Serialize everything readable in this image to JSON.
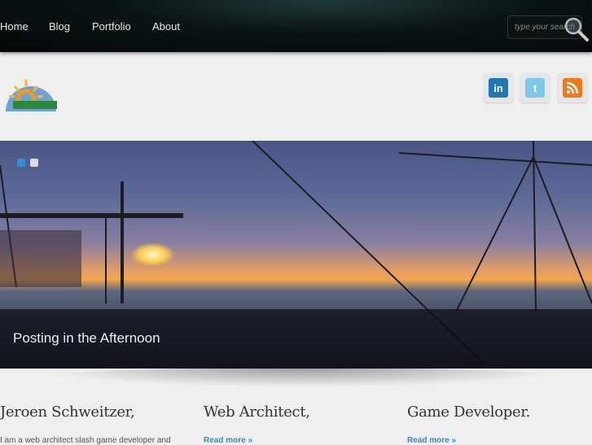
{
  "nav": {
    "items": [
      "Home",
      "Blog",
      "Portfolio",
      "About"
    ]
  },
  "search": {
    "placeholder": "type your search"
  },
  "social": [
    {
      "name": "linkedin",
      "label": "in",
      "color": "#1f78b4"
    },
    {
      "name": "twitter",
      "label": "t",
      "color": "#7ec8ea"
    },
    {
      "name": "rss",
      "label": "",
      "color": "#f07a1a"
    }
  ],
  "slider": {
    "caption": "Posting in the Afternoon"
  },
  "columns": [
    {
      "title": "Jeroen Schweitzer,",
      "text": "I am a web architect slash game developer and"
    },
    {
      "title": "Web Architect,",
      "link": "Read more »"
    },
    {
      "title": "Game Developer.",
      "link": "Read more »"
    }
  ]
}
